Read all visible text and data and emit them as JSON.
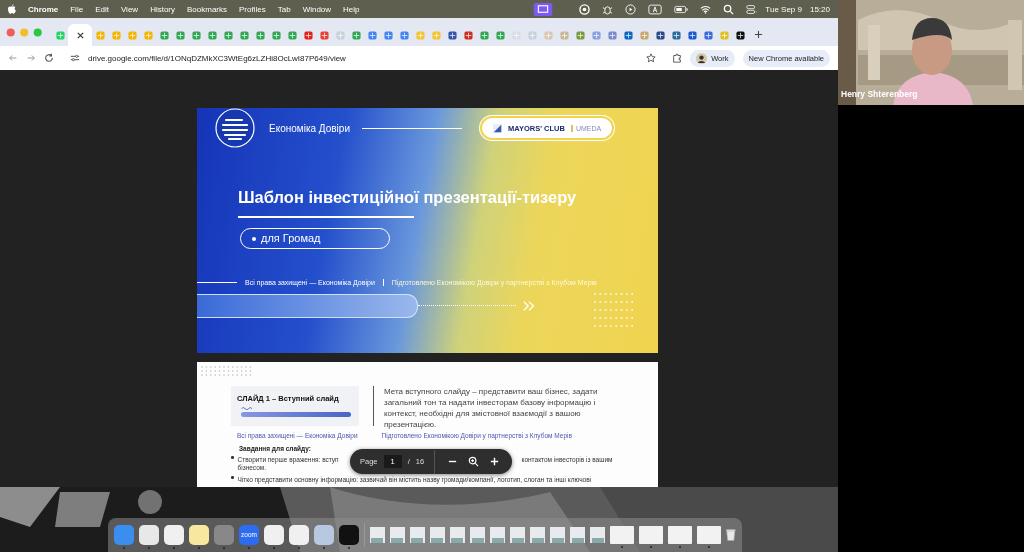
{
  "menu_bar": {
    "app": "Chrome",
    "items": [
      "File",
      "Edit",
      "View",
      "History",
      "Bookmarks",
      "Profiles",
      "Tab",
      "Window",
      "Help"
    ],
    "date": "Tue Sep 9",
    "time": "15:20"
  },
  "tabs": [
    {
      "selected": false
    },
    {
      "selected": true
    },
    {
      "selected": false
    },
    {
      "selected": false
    },
    {
      "selected": false
    },
    {
      "selected": false
    },
    {
      "selected": false
    },
    {
      "selected": false
    },
    {
      "selected": false
    },
    {
      "selected": false
    },
    {
      "selected": false
    },
    {
      "selected": false
    },
    {
      "selected": false
    },
    {
      "selected": false
    },
    {
      "selected": false
    },
    {
      "selected": false
    },
    {
      "selected": false
    },
    {
      "selected": false
    },
    {
      "selected": false
    },
    {
      "selected": false
    },
    {
      "selected": false
    },
    {
      "selected": false
    },
    {
      "selected": false
    },
    {
      "selected": false
    },
    {
      "selected": false
    },
    {
      "selected": false
    },
    {
      "selected": false
    },
    {
      "selected": false
    },
    {
      "selected": false
    },
    {
      "selected": false
    },
    {
      "selected": false
    },
    {
      "selected": false
    },
    {
      "selected": false
    },
    {
      "selected": false
    },
    {
      "selected": false
    },
    {
      "selected": false
    },
    {
      "selected": false
    },
    {
      "selected": false
    },
    {
      "selected": false
    },
    {
      "selected": false
    },
    {
      "selected": false
    },
    {
      "selected": false
    },
    {
      "selected": false
    }
  ],
  "address_bar": {
    "url": "drive.google.com/file/d/1ONqDZMkXC3WtEg6zLZHi8OcLwI87P649/view",
    "profile": "Work",
    "update": "New Chrome available"
  },
  "slide_1": {
    "brand": "Економіка Довіри",
    "partner_1": "MAYORS' CLUB",
    "partner_2": "UMEDA",
    "title": "Шаблон інвестиційної презентації-тизеру",
    "subtitle": "для Громад",
    "footer_left": "Всі права захищені — Економіка Довіри",
    "footer_right": "Підготовлено Економікою Довіри у партнерстві з Клубом Мерів"
  },
  "slide_2": {
    "heading": "СЛАЙД 1 – Вступний слайд",
    "description": "Мета вступного слайду – представити ваш бізнес, задати загальний тон та надати інвесторам базову інформацію і контекст, необхідні для змістовної взаємодії з вашою презентацією.",
    "footer_left": "Всі права захищені — Економіка Довіри",
    "footer_right": "Підготовлено Економікою Довіри у партнерстві з Клубом Мерів",
    "tasks_title": "Завдання для слайду:",
    "tasks": [
      {
        "kind": "split",
        "before": "Створити перше враження: вступ",
        "after": "контактом інвесторів із вашим",
        "rest": "бізнесом."
      },
      {
        "kind": "plain",
        "text": "Чітко представити основну інформацію: зазвичай він містить назву громади/компанії, логотип, слоган та інші ключові"
      }
    ]
  },
  "pdf_toolbar": {
    "label": "Page",
    "page": "1",
    "separator": "/",
    "total": "16"
  },
  "dock": [
    {
      "running": true
    },
    {
      "running": true
    },
    {
      "running": true
    },
    {
      "running": true
    },
    {
      "running": true
    },
    {
      "running": true,
      "label": "zoom"
    },
    {
      "running": true
    },
    {
      "running": true
    },
    {
      "running": true
    },
    {
      "running": true
    },
    {
      "running": true
    },
    {
      "running": true
    },
    {
      "running": true
    },
    {
      "running": true
    }
  ],
  "video": {
    "name": "Henry Shterenberg"
  }
}
